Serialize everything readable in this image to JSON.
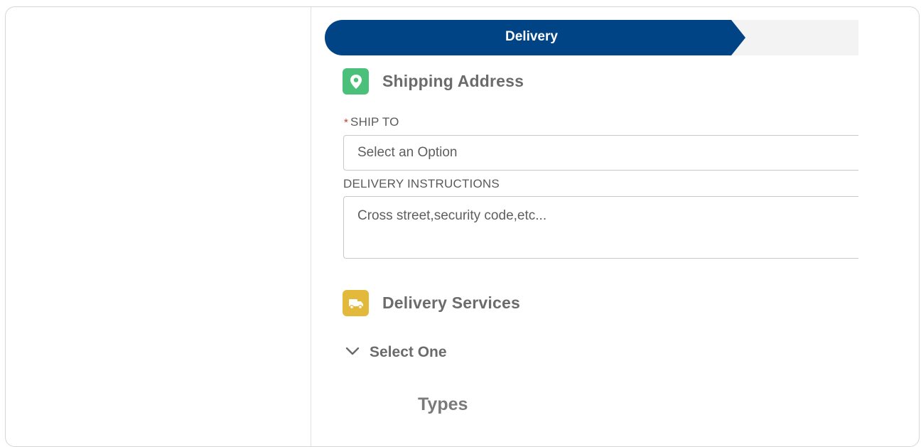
{
  "path": {
    "active_step": "Delivery"
  },
  "shipping_section": {
    "title": "Shipping Address",
    "icon": "map-pin-icon",
    "icon_color": "#4bc07a"
  },
  "ship_to": {
    "required_mark": "*",
    "label": "SHIP TO",
    "value": "Select an Option"
  },
  "delivery_instructions": {
    "label": "DELIVERY INSTRUCTIONS",
    "placeholder": "Cross street,security code,etc..."
  },
  "delivery_services": {
    "title": "Delivery Services",
    "icon": "truck-icon",
    "icon_color": "#e2b93b"
  },
  "select_one": {
    "label": "Select One",
    "icon": "chevron-down-icon"
  },
  "types": {
    "label": "Types"
  },
  "colors": {
    "path_active": "#014486",
    "required": "#c23934"
  }
}
